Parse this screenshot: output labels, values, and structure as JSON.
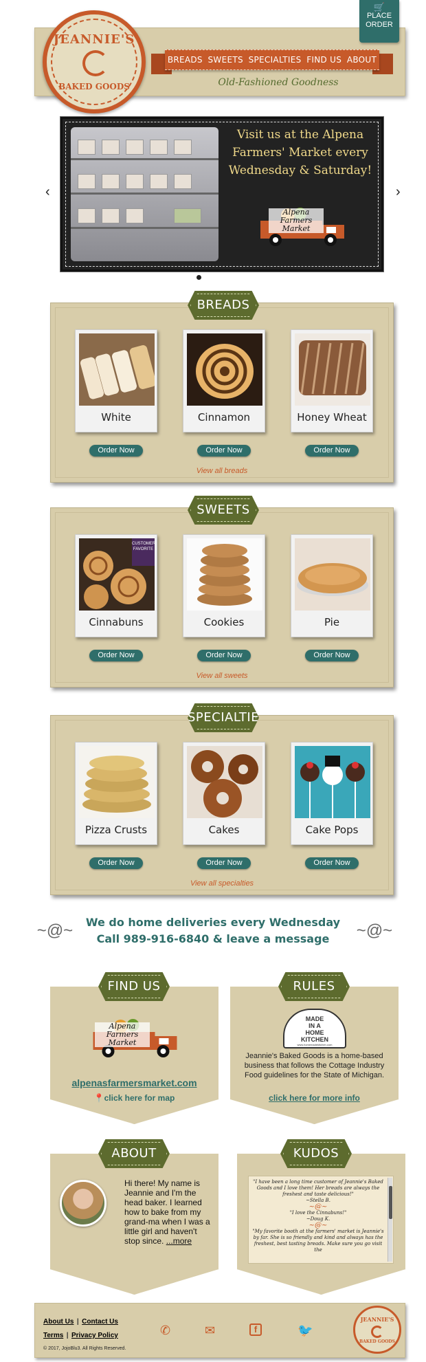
{
  "header": {
    "logo_top": "JEANNIE'S",
    "logo_bottom": "BAKED GOODS",
    "order_tab": {
      "line1": "PLACE",
      "line2": "ORDER"
    },
    "nav": [
      "BREADS",
      "SWEETS",
      "SPECIALTIES",
      "FIND US",
      "ABOUT"
    ],
    "tagline": "Old-Fashioned Goodness"
  },
  "slider": {
    "message": "Visit us at the Alpena Farmers' Market every Wednesday & Saturday!",
    "truck_text": "Alpena Farmers Market",
    "prev": "‹",
    "next": "›"
  },
  "breads": {
    "title": "BREADS",
    "items": [
      {
        "label": "White",
        "button": "Order Now"
      },
      {
        "label": "Cinnamon",
        "button": "Order Now"
      },
      {
        "label": "Honey Wheat",
        "button": "Order Now"
      }
    ],
    "view_all": "View all breads"
  },
  "sweets": {
    "title": "SWEETS",
    "ribbon": "CUSTOMER FAVORITE",
    "items": [
      {
        "label": "Cinnabuns",
        "button": "Order Now"
      },
      {
        "label": "Cookies",
        "button": "Order Now"
      },
      {
        "label": "Pie",
        "button": "Order Now"
      }
    ],
    "view_all": "View all sweets"
  },
  "specialties": {
    "title": "SPECIALTIES",
    "items": [
      {
        "label": "Pizza Crusts",
        "button": "Order Now"
      },
      {
        "label": "Cakes",
        "button": "Order Now"
      },
      {
        "label": "Cake Pops",
        "button": "Order Now"
      }
    ],
    "view_all": "View all specialties"
  },
  "delivery": {
    "line1": "We do home deliveries every Wednesday",
    "line2": "Call 989-916-6840 & leave a message"
  },
  "find_us": {
    "title": "FIND US",
    "url": "alpenasfarmersmarket.com",
    "map_link": "click here for map",
    "truck_text": "Alpena Farmers Market"
  },
  "rules": {
    "title": "RULES",
    "sign_line1": "MADE",
    "sign_line2": "IN A",
    "sign_line3": "HOME",
    "sign_line4": "KITCHEN",
    "sign_small": "www.homemadekitchen.com",
    "text": "Jeannie's Baked Goods is a home-based business that follows the Cottage Industry Food guidelines for the State of Michigan.",
    "link": "click here for more info"
  },
  "about": {
    "title": "ABOUT",
    "text": "Hi there! My name is Jeannie and I'm the head baker. I learned how to bake from my grand-ma when I was a little girl and haven't stop since.",
    "more": "...more"
  },
  "kudos": {
    "title": "KUDOS",
    "q1": "\"I have been a long time customer of Jeannie's Baked Goods and I love them! Her breads are always the freshest and taste delicious!\"",
    "a1": "~Stella B.",
    "q2": "\"I love the Cinnabuns!\"",
    "a2": "~Doug K.",
    "q3": "\"My favorite booth at the farmers' market is Jeannie's by far. She is so friendly and kind and always has the freshest, best tasting breads. Make sure you go visit the"
  },
  "footer": {
    "about": "About Us",
    "contact": "Contact Us",
    "terms": "Terms",
    "privacy": "Privacy Policy",
    "copyright": "© 2017, JojoBlu3. All Rights Reserved.",
    "logo_top": "JEANNIE'S",
    "logo_bottom": "BAKED GOODS"
  },
  "colors": {
    "brand_orange": "#c75a2a",
    "olive": "#5d6b2e",
    "teal": "#2f6e6a",
    "tan": "#d8cdaa"
  },
  "icons": [
    "cart-icon",
    "phone-icon",
    "email-icon",
    "facebook-icon",
    "twitter-icon",
    "map-pin-icon"
  ]
}
